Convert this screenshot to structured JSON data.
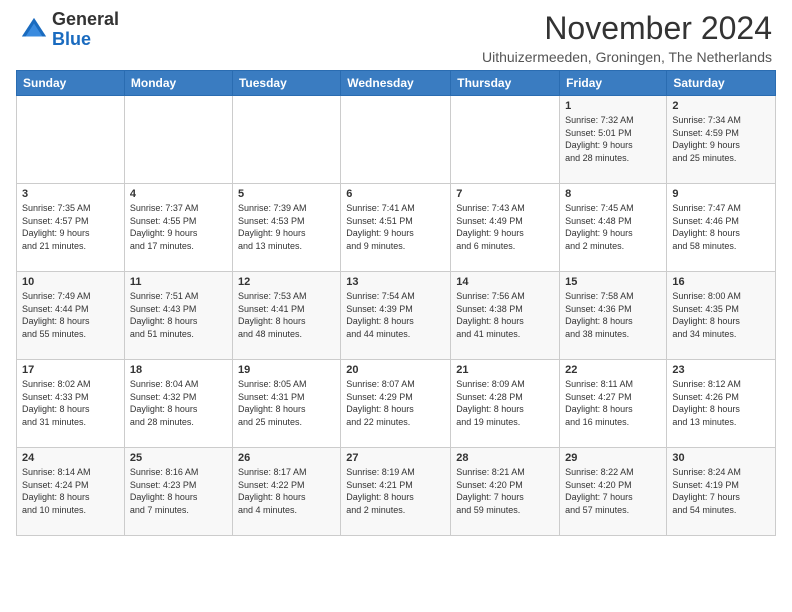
{
  "header": {
    "logo_general": "General",
    "logo_blue": "Blue",
    "month_title": "November 2024",
    "location": "Uithuizermeeden, Groningen, The Netherlands"
  },
  "weekdays": [
    "Sunday",
    "Monday",
    "Tuesday",
    "Wednesday",
    "Thursday",
    "Friday",
    "Saturday"
  ],
  "weeks": [
    [
      {
        "day": "",
        "info": ""
      },
      {
        "day": "",
        "info": ""
      },
      {
        "day": "",
        "info": ""
      },
      {
        "day": "",
        "info": ""
      },
      {
        "day": "",
        "info": ""
      },
      {
        "day": "1",
        "info": "Sunrise: 7:32 AM\nSunset: 5:01 PM\nDaylight: 9 hours\nand 28 minutes."
      },
      {
        "day": "2",
        "info": "Sunrise: 7:34 AM\nSunset: 4:59 PM\nDaylight: 9 hours\nand 25 minutes."
      }
    ],
    [
      {
        "day": "3",
        "info": "Sunrise: 7:35 AM\nSunset: 4:57 PM\nDaylight: 9 hours\nand 21 minutes."
      },
      {
        "day": "4",
        "info": "Sunrise: 7:37 AM\nSunset: 4:55 PM\nDaylight: 9 hours\nand 17 minutes."
      },
      {
        "day": "5",
        "info": "Sunrise: 7:39 AM\nSunset: 4:53 PM\nDaylight: 9 hours\nand 13 minutes."
      },
      {
        "day": "6",
        "info": "Sunrise: 7:41 AM\nSunset: 4:51 PM\nDaylight: 9 hours\nand 9 minutes."
      },
      {
        "day": "7",
        "info": "Sunrise: 7:43 AM\nSunset: 4:49 PM\nDaylight: 9 hours\nand 6 minutes."
      },
      {
        "day": "8",
        "info": "Sunrise: 7:45 AM\nSunset: 4:48 PM\nDaylight: 9 hours\nand 2 minutes."
      },
      {
        "day": "9",
        "info": "Sunrise: 7:47 AM\nSunset: 4:46 PM\nDaylight: 8 hours\nand 58 minutes."
      }
    ],
    [
      {
        "day": "10",
        "info": "Sunrise: 7:49 AM\nSunset: 4:44 PM\nDaylight: 8 hours\nand 55 minutes."
      },
      {
        "day": "11",
        "info": "Sunrise: 7:51 AM\nSunset: 4:43 PM\nDaylight: 8 hours\nand 51 minutes."
      },
      {
        "day": "12",
        "info": "Sunrise: 7:53 AM\nSunset: 4:41 PM\nDaylight: 8 hours\nand 48 minutes."
      },
      {
        "day": "13",
        "info": "Sunrise: 7:54 AM\nSunset: 4:39 PM\nDaylight: 8 hours\nand 44 minutes."
      },
      {
        "day": "14",
        "info": "Sunrise: 7:56 AM\nSunset: 4:38 PM\nDaylight: 8 hours\nand 41 minutes."
      },
      {
        "day": "15",
        "info": "Sunrise: 7:58 AM\nSunset: 4:36 PM\nDaylight: 8 hours\nand 38 minutes."
      },
      {
        "day": "16",
        "info": "Sunrise: 8:00 AM\nSunset: 4:35 PM\nDaylight: 8 hours\nand 34 minutes."
      }
    ],
    [
      {
        "day": "17",
        "info": "Sunrise: 8:02 AM\nSunset: 4:33 PM\nDaylight: 8 hours\nand 31 minutes."
      },
      {
        "day": "18",
        "info": "Sunrise: 8:04 AM\nSunset: 4:32 PM\nDaylight: 8 hours\nand 28 minutes."
      },
      {
        "day": "19",
        "info": "Sunrise: 8:05 AM\nSunset: 4:31 PM\nDaylight: 8 hours\nand 25 minutes."
      },
      {
        "day": "20",
        "info": "Sunrise: 8:07 AM\nSunset: 4:29 PM\nDaylight: 8 hours\nand 22 minutes."
      },
      {
        "day": "21",
        "info": "Sunrise: 8:09 AM\nSunset: 4:28 PM\nDaylight: 8 hours\nand 19 minutes."
      },
      {
        "day": "22",
        "info": "Sunrise: 8:11 AM\nSunset: 4:27 PM\nDaylight: 8 hours\nand 16 minutes."
      },
      {
        "day": "23",
        "info": "Sunrise: 8:12 AM\nSunset: 4:26 PM\nDaylight: 8 hours\nand 13 minutes."
      }
    ],
    [
      {
        "day": "24",
        "info": "Sunrise: 8:14 AM\nSunset: 4:24 PM\nDaylight: 8 hours\nand 10 minutes."
      },
      {
        "day": "25",
        "info": "Sunrise: 8:16 AM\nSunset: 4:23 PM\nDaylight: 8 hours\nand 7 minutes."
      },
      {
        "day": "26",
        "info": "Sunrise: 8:17 AM\nSunset: 4:22 PM\nDaylight: 8 hours\nand 4 minutes."
      },
      {
        "day": "27",
        "info": "Sunrise: 8:19 AM\nSunset: 4:21 PM\nDaylight: 8 hours\nand 2 minutes."
      },
      {
        "day": "28",
        "info": "Sunrise: 8:21 AM\nSunset: 4:20 PM\nDaylight: 7 hours\nand 59 minutes."
      },
      {
        "day": "29",
        "info": "Sunrise: 8:22 AM\nSunset: 4:20 PM\nDaylight: 7 hours\nand 57 minutes."
      },
      {
        "day": "30",
        "info": "Sunrise: 8:24 AM\nSunset: 4:19 PM\nDaylight: 7 hours\nand 54 minutes."
      }
    ]
  ]
}
